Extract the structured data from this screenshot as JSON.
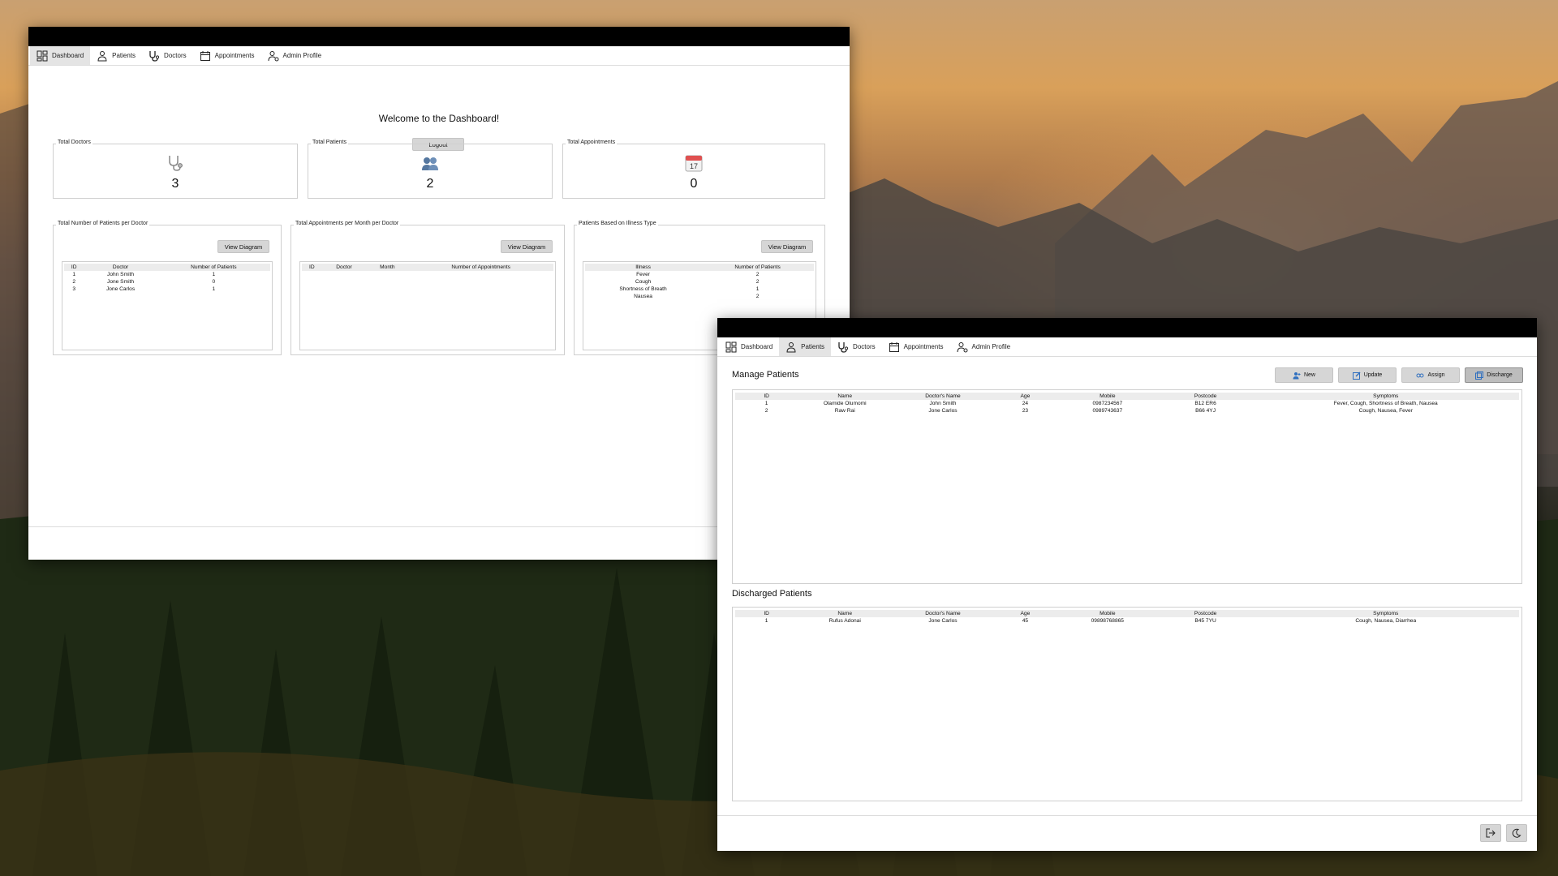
{
  "colors": {
    "titlebar": "#000000",
    "active_tab": "#e4e4e4",
    "button": "#d6d6d6",
    "calendar_red": "#e05050",
    "people_blue": "#5577a0"
  },
  "dashboard": {
    "tabs": [
      {
        "label": "Dashboard",
        "icon": "dashboard-icon",
        "active": true
      },
      {
        "label": "Patients",
        "icon": "patients-icon"
      },
      {
        "label": "Doctors",
        "icon": "stethoscope-icon"
      },
      {
        "label": "Appointments",
        "icon": "calendar-icon"
      },
      {
        "label": "Admin Profile",
        "icon": "admin-icon"
      }
    ],
    "welcome": "Welcome to the Dashboard!",
    "logout_label": "Logout",
    "stats": [
      {
        "label": "Total Doctors",
        "value": "3",
        "icon": "stethoscope-icon"
      },
      {
        "label": "Total Patients",
        "value": "2",
        "icon": "people-icon"
      },
      {
        "label": "Total Appointments",
        "value": "0",
        "icon": "calendar-icon",
        "calendar_day": "17"
      }
    ],
    "panels": [
      {
        "title": "Total Number of Patients per Doctor",
        "button": "View Diagram",
        "columns": [
          "ID",
          "Doctor",
          "Number of Patients"
        ],
        "rows": [
          [
            "1",
            "John Smith",
            "1"
          ],
          [
            "2",
            "Jone Smith",
            "0"
          ],
          [
            "3",
            "Jone Carlos",
            "1"
          ]
        ]
      },
      {
        "title": "Total Appointments per Month per Doctor",
        "button": "View Diagram",
        "columns": [
          "ID",
          "Doctor",
          "Month",
          "Number of Appointments"
        ],
        "rows": []
      },
      {
        "title": "Patients Based on Illness Type",
        "button": "View Diagram",
        "columns": [
          "Illness",
          "Number of Patients"
        ],
        "rows": [
          [
            "Fever",
            "2"
          ],
          [
            "Cough",
            "2"
          ],
          [
            "Shortness of Breath",
            "1"
          ],
          [
            "Nausea",
            "2"
          ]
        ]
      }
    ]
  },
  "patients_window": {
    "tabs": [
      {
        "label": "Dashboard",
        "icon": "dashboard-icon"
      },
      {
        "label": "Patients",
        "icon": "patients-icon",
        "active": true
      },
      {
        "label": "Doctors",
        "icon": "stethoscope-icon"
      },
      {
        "label": "Appointments",
        "icon": "calendar-icon"
      },
      {
        "label": "Admin Profile",
        "icon": "admin-icon"
      }
    ],
    "manage_title": "Manage Patients",
    "actions": [
      {
        "label": "New",
        "icon": "add-user-icon"
      },
      {
        "label": "Update",
        "icon": "edit-icon"
      },
      {
        "label": "Assign",
        "icon": "assign-icon"
      },
      {
        "label": "Discharge",
        "icon": "discharge-icon",
        "active": true
      }
    ],
    "columns": [
      "ID",
      "Name",
      "Doctor's Name",
      "Age",
      "Mobile",
      "Postcode",
      "Symptoms"
    ],
    "patients": [
      [
        "1",
        "Olamide Olumomi",
        "John Smith",
        "24",
        "0987234567",
        "B12 ER6",
        "Fever, Cough, Shortness of Breath, Nausea"
      ],
      [
        "2",
        "Raw Rai",
        "Jone Carlos",
        "23",
        "0989743637",
        "B66 4YJ",
        "Cough, Nausea, Fever"
      ]
    ],
    "discharged_title": "Discharged Patients",
    "discharged": [
      [
        "1",
        "Rufus Adonai",
        "Jone Carlos",
        "45",
        "09898768865",
        "B45 7YU",
        "Cough, Nausea, Diarrhea"
      ]
    ],
    "footer_icons": [
      "logout-icon",
      "dark-mode-icon"
    ]
  }
}
